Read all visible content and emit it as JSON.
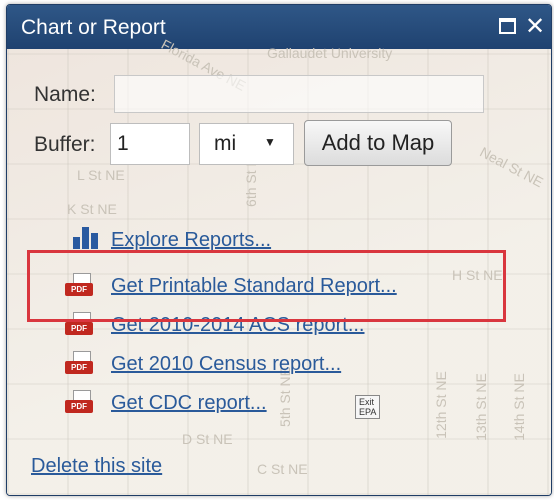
{
  "window": {
    "title": "Chart or Report"
  },
  "form": {
    "name_label": "Name:",
    "name_value": "",
    "buffer_label": "Buffer:",
    "buffer_value": "1",
    "unit_value": "mi",
    "add_button": "Add to Map"
  },
  "reports": [
    {
      "label": "Explore Reports...",
      "icon": "bar-chart-icon"
    },
    {
      "label": "Get Printable Standard Report...",
      "icon": "pdf-icon"
    },
    {
      "label": "Get 2010-2014 ACS report...",
      "icon": "pdf-icon"
    },
    {
      "label": "Get 2010 Census report...",
      "icon": "pdf-icon"
    },
    {
      "label": "Get CDC report...",
      "icon": "pdf-icon",
      "badge": "Exit EPA"
    }
  ],
  "pdf_icon_text": "PDF",
  "delete_link": "Delete this site",
  "map_labels": [
    "Florida Ave NE",
    "Gallaudet University",
    "L St NE",
    "K St NE",
    "Neal St NE",
    "H St NE",
    "D St NE",
    "C St NE",
    "5th St NE",
    "6th St NE",
    "12th St NE",
    "13th St NE",
    "14th St NE"
  ],
  "colors": {
    "titlebar": "#1f4270",
    "link": "#2a5a9a",
    "highlight": "#d9363e",
    "pdf": "#c0281f"
  }
}
